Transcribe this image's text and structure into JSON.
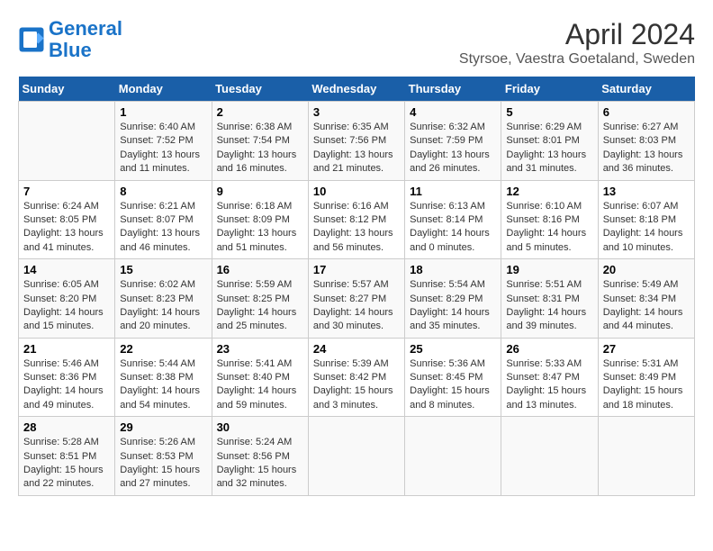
{
  "header": {
    "logo_line1": "General",
    "logo_line2": "Blue",
    "month": "April 2024",
    "location": "Styrsoe, Vaestra Goetaland, Sweden"
  },
  "weekdays": [
    "Sunday",
    "Monday",
    "Tuesday",
    "Wednesday",
    "Thursday",
    "Friday",
    "Saturday"
  ],
  "weeks": [
    [
      {
        "day": "",
        "info": ""
      },
      {
        "day": "1",
        "info": "Sunrise: 6:40 AM\nSunset: 7:52 PM\nDaylight: 13 hours\nand 11 minutes."
      },
      {
        "day": "2",
        "info": "Sunrise: 6:38 AM\nSunset: 7:54 PM\nDaylight: 13 hours\nand 16 minutes."
      },
      {
        "day": "3",
        "info": "Sunrise: 6:35 AM\nSunset: 7:56 PM\nDaylight: 13 hours\nand 21 minutes."
      },
      {
        "day": "4",
        "info": "Sunrise: 6:32 AM\nSunset: 7:59 PM\nDaylight: 13 hours\nand 26 minutes."
      },
      {
        "day": "5",
        "info": "Sunrise: 6:29 AM\nSunset: 8:01 PM\nDaylight: 13 hours\nand 31 minutes."
      },
      {
        "day": "6",
        "info": "Sunrise: 6:27 AM\nSunset: 8:03 PM\nDaylight: 13 hours\nand 36 minutes."
      }
    ],
    [
      {
        "day": "7",
        "info": "Sunrise: 6:24 AM\nSunset: 8:05 PM\nDaylight: 13 hours\nand 41 minutes."
      },
      {
        "day": "8",
        "info": "Sunrise: 6:21 AM\nSunset: 8:07 PM\nDaylight: 13 hours\nand 46 minutes."
      },
      {
        "day": "9",
        "info": "Sunrise: 6:18 AM\nSunset: 8:09 PM\nDaylight: 13 hours\nand 51 minutes."
      },
      {
        "day": "10",
        "info": "Sunrise: 6:16 AM\nSunset: 8:12 PM\nDaylight: 13 hours\nand 56 minutes."
      },
      {
        "day": "11",
        "info": "Sunrise: 6:13 AM\nSunset: 8:14 PM\nDaylight: 14 hours\nand 0 minutes."
      },
      {
        "day": "12",
        "info": "Sunrise: 6:10 AM\nSunset: 8:16 PM\nDaylight: 14 hours\nand 5 minutes."
      },
      {
        "day": "13",
        "info": "Sunrise: 6:07 AM\nSunset: 8:18 PM\nDaylight: 14 hours\nand 10 minutes."
      }
    ],
    [
      {
        "day": "14",
        "info": "Sunrise: 6:05 AM\nSunset: 8:20 PM\nDaylight: 14 hours\nand 15 minutes."
      },
      {
        "day": "15",
        "info": "Sunrise: 6:02 AM\nSunset: 8:23 PM\nDaylight: 14 hours\nand 20 minutes."
      },
      {
        "day": "16",
        "info": "Sunrise: 5:59 AM\nSunset: 8:25 PM\nDaylight: 14 hours\nand 25 minutes."
      },
      {
        "day": "17",
        "info": "Sunrise: 5:57 AM\nSunset: 8:27 PM\nDaylight: 14 hours\nand 30 minutes."
      },
      {
        "day": "18",
        "info": "Sunrise: 5:54 AM\nSunset: 8:29 PM\nDaylight: 14 hours\nand 35 minutes."
      },
      {
        "day": "19",
        "info": "Sunrise: 5:51 AM\nSunset: 8:31 PM\nDaylight: 14 hours\nand 39 minutes."
      },
      {
        "day": "20",
        "info": "Sunrise: 5:49 AM\nSunset: 8:34 PM\nDaylight: 14 hours\nand 44 minutes."
      }
    ],
    [
      {
        "day": "21",
        "info": "Sunrise: 5:46 AM\nSunset: 8:36 PM\nDaylight: 14 hours\nand 49 minutes."
      },
      {
        "day": "22",
        "info": "Sunrise: 5:44 AM\nSunset: 8:38 PM\nDaylight: 14 hours\nand 54 minutes."
      },
      {
        "day": "23",
        "info": "Sunrise: 5:41 AM\nSunset: 8:40 PM\nDaylight: 14 hours\nand 59 minutes."
      },
      {
        "day": "24",
        "info": "Sunrise: 5:39 AM\nSunset: 8:42 PM\nDaylight: 15 hours\nand 3 minutes."
      },
      {
        "day": "25",
        "info": "Sunrise: 5:36 AM\nSunset: 8:45 PM\nDaylight: 15 hours\nand 8 minutes."
      },
      {
        "day": "26",
        "info": "Sunrise: 5:33 AM\nSunset: 8:47 PM\nDaylight: 15 hours\nand 13 minutes."
      },
      {
        "day": "27",
        "info": "Sunrise: 5:31 AM\nSunset: 8:49 PM\nDaylight: 15 hours\nand 18 minutes."
      }
    ],
    [
      {
        "day": "28",
        "info": "Sunrise: 5:28 AM\nSunset: 8:51 PM\nDaylight: 15 hours\nand 22 minutes."
      },
      {
        "day": "29",
        "info": "Sunrise: 5:26 AM\nSunset: 8:53 PM\nDaylight: 15 hours\nand 27 minutes."
      },
      {
        "day": "30",
        "info": "Sunrise: 5:24 AM\nSunset: 8:56 PM\nDaylight: 15 hours\nand 32 minutes."
      },
      {
        "day": "",
        "info": ""
      },
      {
        "day": "",
        "info": ""
      },
      {
        "day": "",
        "info": ""
      },
      {
        "day": "",
        "info": ""
      }
    ]
  ]
}
